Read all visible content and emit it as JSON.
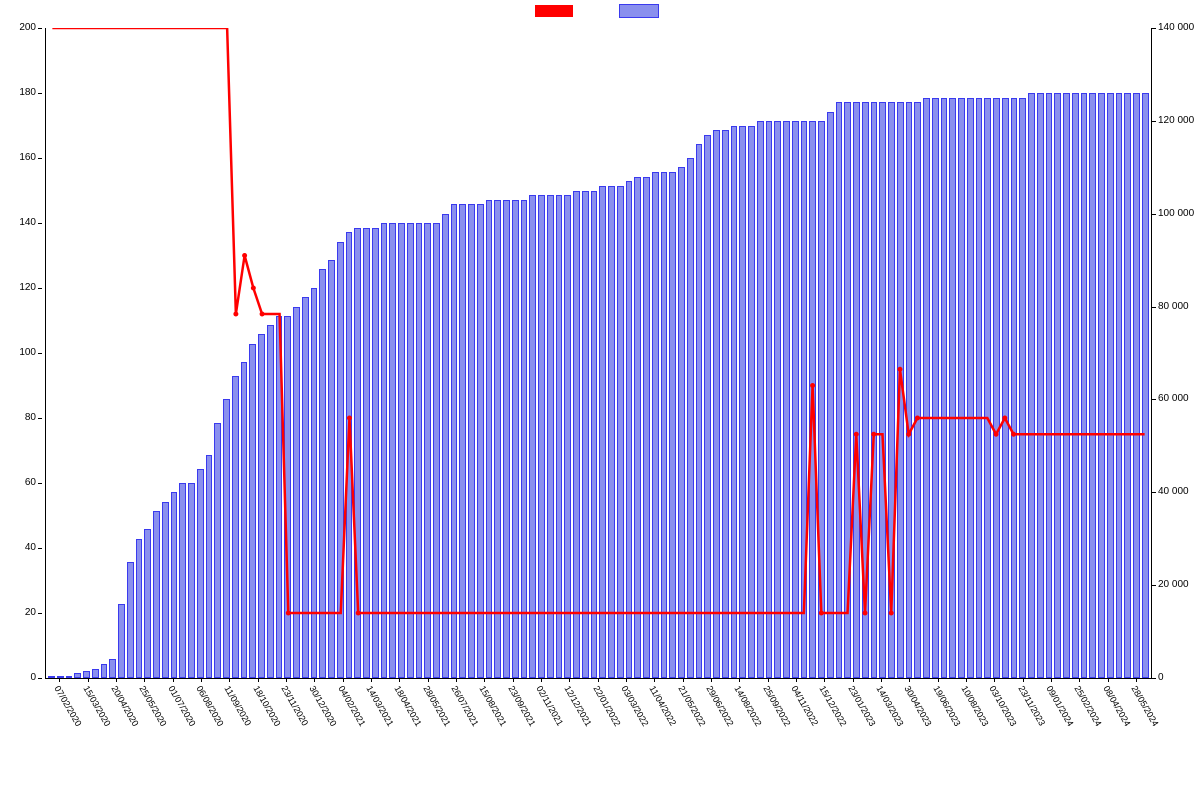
{
  "legend": {
    "series1_label": "",
    "series2_label": ""
  },
  "chart_data": {
    "type": "bar",
    "title": "",
    "xlabel": "",
    "ylabel_left": "",
    "ylabel_right": "",
    "ylim_left": [
      0,
      200
    ],
    "ylim_right": [
      0,
      140000
    ],
    "y_ticks_left": [
      0,
      20,
      40,
      60,
      80,
      100,
      120,
      140,
      160,
      180,
      200
    ],
    "y_ticks_right": [
      0,
      20000,
      40000,
      60000,
      80000,
      100000,
      120000,
      140000
    ],
    "y_ticks_right_labels": [
      "0",
      "20 000",
      "40 000",
      "60 000",
      "80 000",
      "100 000",
      "120 000",
      "140 000"
    ],
    "x_labels_shown": [
      "07/02/2020",
      "15/03/2020",
      "20/04/2020",
      "25/05/2020",
      "01/07/2020",
      "06/08/2020",
      "11/09/2020",
      "18/10/2020",
      "23/11/2020",
      "30/12/2020",
      "04/02/2021",
      "14/03/2021",
      "18/04/2021",
      "28/05/2021",
      "26/07/2021",
      "15/08/2021",
      "23/09/2021",
      "02/11/2021",
      "12/12/2021",
      "22/01/2022",
      "03/03/2022",
      "11/04/2022",
      "21/05/2022",
      "29/06/2022",
      "14/08/2022",
      "25/09/2022",
      "04/11/2022",
      "15/12/2022",
      "23/01/2023",
      "14/03/2023",
      "30/04/2023",
      "19/06/2023",
      "10/08/2023",
      "03/10/2023",
      "23/11/2023",
      "09/01/2024",
      "25/02/2024",
      "08/04/2024",
      "28/05/2024"
    ],
    "series": [
      {
        "name": "line",
        "axis": "left",
        "color": "#ff0000",
        "values": [
          200,
          200,
          200,
          200,
          200,
          200,
          200,
          200,
          200,
          200,
          200,
          200,
          200,
          200,
          200,
          200,
          200,
          200,
          200,
          200,
          200,
          112,
          130,
          120,
          112,
          112,
          112,
          20,
          20,
          20,
          20,
          20,
          20,
          20,
          80,
          20,
          20,
          20,
          20,
          20,
          20,
          20,
          20,
          20,
          20,
          20,
          20,
          20,
          20,
          20,
          20,
          20,
          20,
          20,
          20,
          20,
          20,
          20,
          20,
          20,
          20,
          20,
          20,
          20,
          20,
          20,
          20,
          20,
          20,
          20,
          20,
          20,
          20,
          20,
          20,
          20,
          20,
          20,
          20,
          20,
          20,
          20,
          20,
          20,
          20,
          20,
          20,
          90,
          20,
          20,
          20,
          20,
          75,
          20,
          75,
          75,
          20,
          95,
          75,
          80,
          80,
          80,
          80,
          80,
          80,
          80,
          80,
          80,
          75,
          80,
          75,
          75,
          75,
          75,
          75,
          75,
          75,
          75,
          75,
          75,
          75,
          75,
          75,
          75,
          75,
          75
        ]
      },
      {
        "name": "bars",
        "axis": "right",
        "color": "#8a90ee",
        "values": [
          0,
          0,
          500,
          1000,
          1500,
          2000,
          3000,
          4000,
          16000,
          25000,
          30000,
          32000,
          36000,
          38000,
          40000,
          42000,
          42000,
          45000,
          48000,
          55000,
          60000,
          65000,
          68000,
          72000,
          74000,
          76000,
          78000,
          78000,
          80000,
          82000,
          84000,
          88000,
          90000,
          94000,
          96000,
          97000,
          97000,
          97000,
          98000,
          98000,
          98000,
          98000,
          98000,
          98000,
          98000,
          100000,
          102000,
          102000,
          102000,
          102000,
          103000,
          103000,
          103000,
          103000,
          103000,
          104000,
          104000,
          104000,
          104000,
          104000,
          105000,
          105000,
          105000,
          106000,
          106000,
          106000,
          107000,
          108000,
          108000,
          109000,
          109000,
          109000,
          110000,
          112000,
          115000,
          117000,
          118000,
          118000,
          119000,
          119000,
          119000,
          120000,
          120000,
          120000,
          120000,
          120000,
          120000,
          120000,
          120000,
          122000,
          124000,
          124000,
          124000,
          124000,
          124000,
          124000,
          124000,
          124000,
          124000,
          124000,
          125000,
          125000,
          125000,
          125000,
          125000,
          125000,
          125000,
          125000,
          125000,
          125000,
          125000,
          125000,
          126000,
          126000,
          126000,
          126000,
          126000,
          126000,
          126000,
          126000,
          126000,
          126000,
          126000,
          126000,
          126000,
          126000
        ]
      }
    ]
  }
}
